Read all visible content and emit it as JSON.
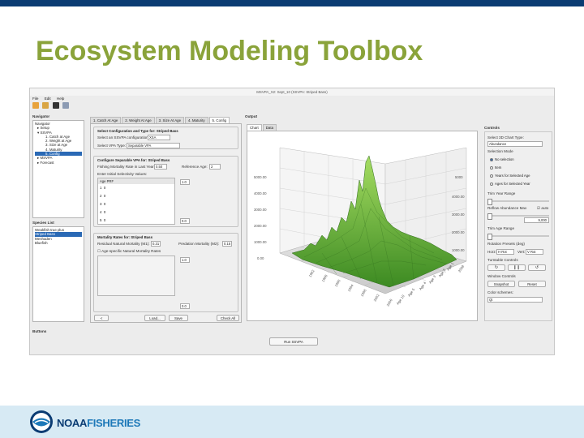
{
  "slide": {
    "title": "Ecosystem Modeling Toolbox",
    "footer_brand_noaa": "NOAA",
    "footer_brand_fisheries": "FISHERIES"
  },
  "app": {
    "window_title": "MSVPA_X2: Sept_10 (SSVPA: Striped Bass)",
    "menu": [
      "File",
      "Edit",
      "Help"
    ],
    "navigator": {
      "title": "Navigator",
      "header": "Navigator",
      "items": [
        "Setup",
        "SSVPA",
        "1. Catch at Age",
        "2. Weight at Age",
        "3. Size at Age",
        "4. Maturity",
        "5. Config",
        "MSVPA",
        "Forecast"
      ]
    },
    "species": {
      "title": "Species List",
      "items": [
        "Weakfish true plus",
        "Striped Bass",
        "Menhaden",
        "Bluefish"
      ]
    },
    "tabs": [
      "1. Catch At Age",
      "2. Weight At Age",
      "3. Size At Age",
      "4. Maturity",
      "5. Config"
    ],
    "config": {
      "group1_title": "Select Configuration and Type for:  Striped Bass",
      "ssvpa_config_label": "Select an SSVPA configuration:",
      "ssvpa_config_value": "XSA",
      "vpa_type_label": "Select VPA Type:",
      "vpa_type_value": "Separable VPA",
      "group2_title": "Configure Separable VPA for:  Striped Bass",
      "fishing_mort_label": "Fishing Mortality Rate in Last Year:",
      "fishing_mort_value": "0.50",
      "ref_age_label": "Reference Age:",
      "ref_age_value": "2",
      "selectivity_label": "Enter Initial Selectivity Values:",
      "sel_header_age": "Age",
      "sel_header_pr": "PRF",
      "sel_rows": [
        [
          "1",
          "0"
        ],
        [
          "2",
          "0"
        ],
        [
          "3",
          "0"
        ],
        [
          "4",
          "0"
        ],
        [
          "5",
          "0"
        ]
      ],
      "sel_spin_top": "1.0",
      "sel_spin_bottom": "0.0",
      "group3_title": "Mortality Rates for:  Striped Bass",
      "residual_label": "Residual Natural Mortality (M1):",
      "residual_value": "0.31",
      "predation_label": "Predation Mortality (M2):",
      "predation_value": "0.15",
      "age_specific_label": "Age-specific Natural Mortality Rates",
      "mort_spin_top": "1.0",
      "mort_spin_bottom": "0.0",
      "btn_back": "<",
      "btn_load": "Load...",
      "btn_save": "Save",
      "btn_check": "Check All"
    },
    "output": {
      "title": "Output",
      "tab_chart": "Chart",
      "tab_data": "Data",
      "z_ticks_left": [
        "5000.00",
        "4000.00",
        "3000.00",
        "2000.00",
        "1000.00",
        "0.00"
      ],
      "z_ticks_right": [
        "5000",
        "4000.00",
        "3000.00",
        "2000.00",
        "1000.00"
      ],
      "year_ticks": [
        "1982",
        "1986",
        "1990",
        "1994",
        "1998",
        "2002",
        "2006"
      ],
      "age_ticks": [
        "Age 1",
        "Age 2",
        "Age 3",
        "Age 4",
        "Age 5",
        "Age 10",
        "2008"
      ]
    },
    "controls": {
      "title": "Controls",
      "chart_type_label": "Select 3D Chart Type:",
      "chart_type_value": "Abundance",
      "selection_mode_label": "Selection Mode",
      "modes": [
        "No selection",
        "Item",
        "Years for Selected Age",
        "Ages for Selected Year"
      ],
      "trim_year_label": "Trim Year Range",
      "reflow_label": "Reflow Abundance Max",
      "auto_label": "auto",
      "reflow_value": "9,000",
      "trim_age_label": "Trim Age Range",
      "rotation_label": "Rotation Presets (deg)",
      "horz_label": "Horz:",
      "horz_value": "H Rot",
      "vert_label": "Vert:",
      "vert_value": "V Rot",
      "turntable_label": "Turntable Controls",
      "window_label": "Window Controls",
      "snapshot": "Snapshot",
      "reset": "Reset",
      "color_label": "Color schemes:",
      "color_value": "Qt"
    },
    "buttons_panel": "Buttons",
    "run_button": "Run SSVPA",
    "colors": {
      "accent": "#2a69b5",
      "surface": "#6fb53a",
      "title_green": "#8aa33a"
    }
  }
}
